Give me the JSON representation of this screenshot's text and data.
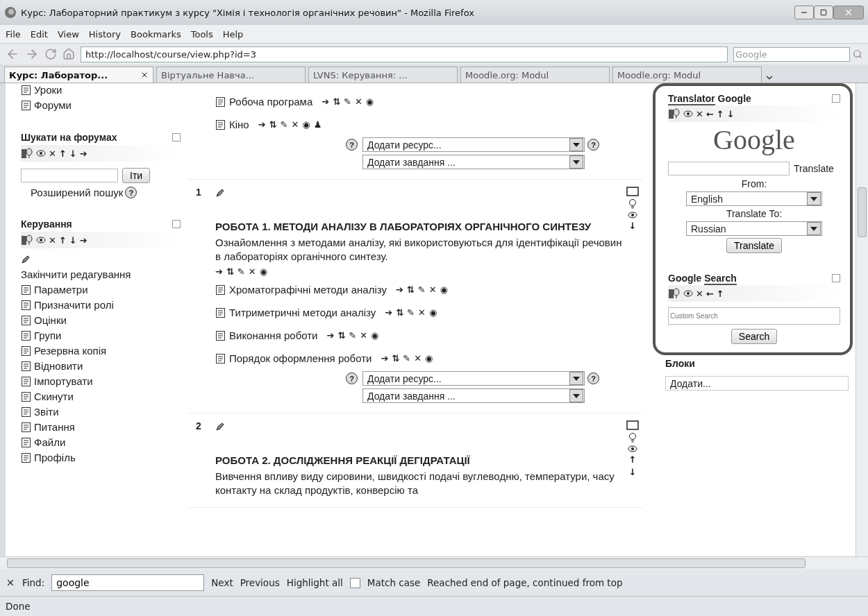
{
  "window": {
    "title": "Курс: Лабораторний практикум з курсу \"Хімія і технологія органічних речовин\" - Mozilla Firefox"
  },
  "menu": [
    {
      "label": "File"
    },
    {
      "label": "Edit"
    },
    {
      "label": "View"
    },
    {
      "label": "History"
    },
    {
      "label": "Bookmarks"
    },
    {
      "label": "Tools"
    },
    {
      "label": "Help"
    }
  ],
  "navigation": {
    "url": "http://localhost/course/view.php?id=3",
    "search": {
      "placeholder": "Google"
    }
  },
  "tabs": [
    {
      "label": "Курс: Лаборатор...",
      "selected": true
    },
    {
      "label": "Віртуальне Навча...",
      "selected": false
    },
    {
      "label": "LVNS: Керування: ...",
      "selected": false
    },
    {
      "label": "Moodle.org: Modul",
      "selected": false
    },
    {
      "label": "Moodle.org: Modul",
      "selected": false
    }
  ],
  "sidebar": {
    "top_items": [
      {
        "label": "Уроки"
      },
      {
        "label": "Форуми"
      }
    ],
    "forum_search": {
      "title": "Шукати на форумах",
      "controls": [
        "✕",
        "↑",
        "↓",
        "➔"
      ],
      "button": "Іти",
      "advanced_link": "Розширений пошук",
      "help": "?"
    },
    "admin": {
      "title": "Керування",
      "controls": [
        "✕",
        "↑",
        "↓",
        "➔"
      ],
      "finish_editing": "Закінчити редагування",
      "items": [
        {
          "label": "Параметри"
        },
        {
          "label": "Призначити ролі"
        },
        {
          "label": "Оцінки"
        },
        {
          "label": "Групи"
        },
        {
          "label": "Резервна копія"
        },
        {
          "label": "Відновити"
        },
        {
          "label": "Імпортувати"
        },
        {
          "label": "Скинути"
        },
        {
          "label": "Звіти"
        },
        {
          "label": "Питання"
        },
        {
          "label": "Файли"
        },
        {
          "label": "Профіль"
        }
      ]
    }
  },
  "sections": [
    {
      "resources": [
        {
          "label": "Робоча програма",
          "actions": [
            "➔",
            "⇅",
            "✎",
            "✕",
            "◉"
          ]
        },
        {
          "label": "Кіно",
          "actions": [
            "➔",
            "⇅",
            "✎",
            "✕",
            "◉",
            "♟"
          ]
        }
      ],
      "add": {
        "help": "?",
        "resource": "Додати ресурс...",
        "activity": "Додати завдання ..."
      }
    },
    {
      "number": "1",
      "side_arrows": [
        "↓"
      ],
      "heading": "РОБОТА 1. МЕТОДИ АНАЛІЗУ В ЛАБОРАТОРІЯХ ОРГАНІЧНОГО СИНТЕЗУ",
      "description": "Ознайомлення з методами аналізу, які використовуються для ідентифікації речовин в лабораторіях органічного синтезу.",
      "actions": [
        "➔",
        "⇅",
        "✎",
        "✕",
        "◉"
      ],
      "resources": [
        {
          "label": "Хроматографічні методи аналізу",
          "actions": [
            "➔",
            "⇅",
            "✎",
            "✕",
            "◉"
          ]
        },
        {
          "label": "Титриметричні методи аналізу",
          "actions": [
            "➔",
            "⇅",
            "✎",
            "✕",
            "◉"
          ]
        },
        {
          "label": "Виконання роботи",
          "actions": [
            "➔",
            "⇅",
            "✎",
            "✕",
            "◉"
          ]
        },
        {
          "label": "Порядок оформлення роботи",
          "actions": [
            "➔",
            "⇅",
            "✎",
            "✕",
            "◉"
          ]
        }
      ],
      "add": {
        "help": "?",
        "resource": "Додати ресурс...",
        "activity": "Додати завдання ..."
      }
    },
    {
      "number": "2",
      "side_arrows": [
        "↑",
        "↓"
      ],
      "heading": "РОБОТА 2. ДОСЛІДЖЕННЯ РЕАКЦІЇ ДЕГІДРАТАЦІЇ",
      "description": "Вивчення впливу виду сировини, швидкості подачі вуглеводню, температури, часу контакту на склад продуктів, конверсію та"
    }
  ],
  "right_blocks": {
    "translator": {
      "title_marked": "Translator",
      "title_rest": "Google",
      "controls": [
        "✕",
        "←",
        "↑",
        "↓"
      ],
      "logo": "Google",
      "translate_label": "Translate",
      "from_label": "From:",
      "from_value": "English",
      "to_label": "Translate To:",
      "to_value": "Russian",
      "button": "Translate"
    },
    "search": {
      "title_rest": "Google",
      "title_marked": "Search",
      "controls": [
        "✕",
        "←",
        "↑"
      ],
      "placeholder": "Custom Search",
      "button": "Search"
    },
    "blocks": {
      "title": "Блоки",
      "select": "Додати..."
    }
  },
  "find_bar": {
    "label": "Find:",
    "value": "google",
    "next": {
      "label": "Next"
    },
    "previous": {
      "label": "Previous"
    },
    "highlight": {
      "label": "Highlight all"
    },
    "match_case": {
      "label": "Match case",
      "checked": false
    },
    "message": "Reached end of page, continued from top"
  },
  "status_bar": {
    "text": "Done"
  }
}
